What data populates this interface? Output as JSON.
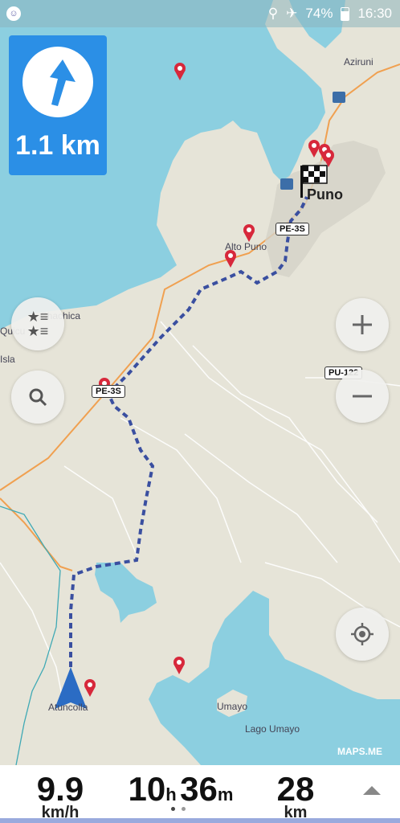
{
  "status": {
    "battery": "74%",
    "time": "16:30"
  },
  "navigation": {
    "turn_distance": "1.1 km",
    "speed_value": "9.9",
    "speed_unit": "km/h",
    "time_hours": "10",
    "time_hours_unit": "h",
    "time_minutes": "36",
    "time_minutes_unit": "m",
    "distance_value": "28",
    "distance_unit": "km"
  },
  "map": {
    "labels": {
      "aziruni": "Aziruni",
      "puno": "Puno",
      "alto_puno": "Alto Puno",
      "chachica": "Chachica",
      "quicu": "Quicu",
      "isla": "Isla",
      "umayo": "Umayo",
      "lago_umayo": "Lago Umayo",
      "atuncolla": "Atuncolla",
      "watermark": "MAPS.ME"
    },
    "shields": {
      "pe3s_top": "PE-3S",
      "pe3s_mid": "PE-3S",
      "pu122": "PU-122"
    }
  },
  "colors": {
    "water": "#8ccfe0",
    "land": "#e6e4d8",
    "route": "#3a4fa0",
    "accent": "#2b8fe6",
    "pin": "#d7283b"
  }
}
